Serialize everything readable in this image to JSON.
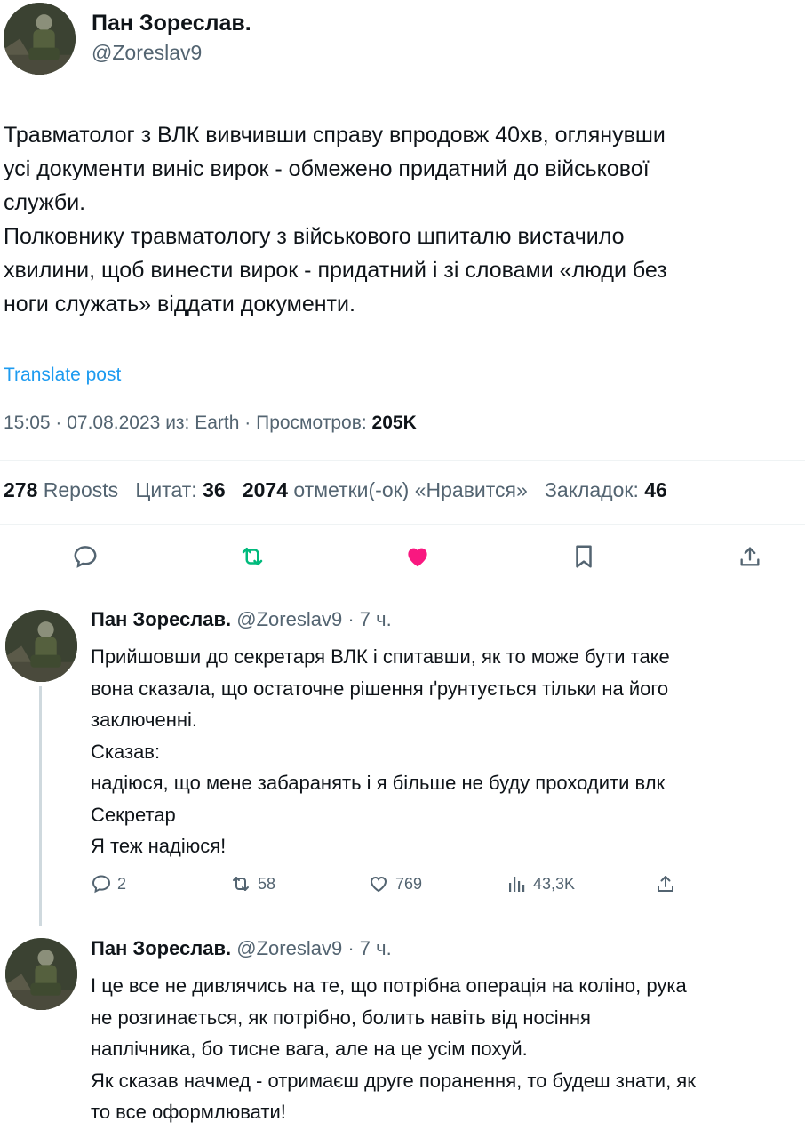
{
  "main_tweet": {
    "author_name": "Пан Зореслав.",
    "handle": "@Zoreslav9",
    "text_lines": [
      "Травматолог з ВЛК вивчивши справу впродовж 40хв, оглянувши",
      "усі документи виніс вирок - обмежено придатний до військової",
      "служби.",
      "Полковнику травматологу з військового шпиталю вистачило",
      "хвилини, щоб винести вирок - придатний і зі словами «люди без",
      "ноги служать» віддати документи."
    ],
    "translate_label": "Translate post",
    "meta": {
      "time": "15:05",
      "date": "07.08.2023",
      "source_prefix": "из:",
      "source": "Earth",
      "views_label": "Просмотров:",
      "views_value": "205K"
    },
    "stats": {
      "reposts_value": "278",
      "reposts_label": "Reposts",
      "quotes_label": "Цитат:",
      "quotes_value": "36",
      "likes_value": "2074",
      "likes_label": "отметки(-ок) «Нравится»",
      "bookmarks_label": "Закладок:",
      "bookmarks_value": "46"
    },
    "actions": [
      "reply-icon",
      "repost-icon",
      "like-icon-filled",
      "bookmark-icon",
      "share-icon"
    ]
  },
  "replies": [
    {
      "author_name": "Пан Зореслав.",
      "handle": "@Zoreslav9",
      "separator": "·",
      "time_ago": "7 ч.",
      "text_lines": [
        "Прийшовши до секретаря ВЛК і спитавши, як то може бути таке",
        "вона сказала, що остаточне рішення ґрунтується тільки на його",
        "заключенні.",
        "Сказав:",
        "надіюся, що мене забаранять і я більше не буду проходити влк",
        "Секретар",
        "Я теж надіюся!"
      ],
      "actions": {
        "replies": "2",
        "reposts": "58",
        "likes": "769",
        "views": "43,3K"
      }
    },
    {
      "author_name": "Пан Зореслав.",
      "handle": "@Zoreslav9",
      "separator": "·",
      "time_ago": "7 ч.",
      "text_lines": [
        "І це все не дивлячись на те, що потрібна операція на коліно, рука",
        "не розгинається, як потрібно, болить навіть від носіння",
        "наплічника, бо тисне вага, але на це усім похуй.",
        "Як сказав начмед - отримаєш друге поранення, то будеш знати, як",
        "то все оформлювати!"
      ]
    }
  ],
  "colors": {
    "text": "#0f1419",
    "muted": "#536471",
    "link": "#1d9bf0",
    "repost_green": "#00ba7c",
    "like_pink": "#f91880",
    "divider": "#eff3f4"
  }
}
